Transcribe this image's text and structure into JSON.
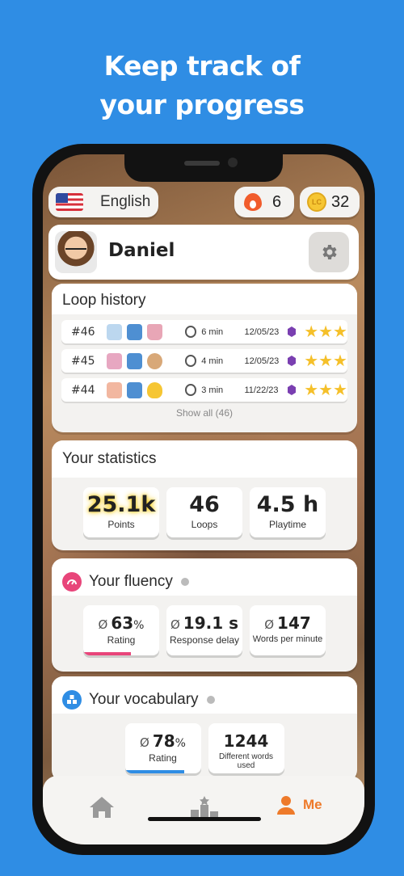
{
  "headline": [
    "Keep track of",
    "your progress"
  ],
  "top_bar": {
    "language": "English",
    "streak": "6",
    "coins": "32",
    "coin_mark": "LC"
  },
  "profile": {
    "name": "Daniel"
  },
  "loop_history": {
    "title": "Loop history",
    "rows": [
      {
        "num": "#46",
        "duration": "6 min",
        "date": "12/05/23",
        "stars": "★★★"
      },
      {
        "num": "#45",
        "duration": "4 min",
        "date": "12/05/23",
        "stars": "★★★"
      },
      {
        "num": "#44",
        "duration": "3 min",
        "date": "11/22/23",
        "stars": "★★★"
      }
    ],
    "show_all": "Show all (46)"
  },
  "statistics": {
    "title": "Your statistics",
    "tiles": [
      {
        "value": "25.1k",
        "label": "Points"
      },
      {
        "value": "46",
        "label": "Loops"
      },
      {
        "value": "4.5 h",
        "label": "Playtime"
      }
    ]
  },
  "fluency": {
    "title": "Your fluency",
    "tiles": [
      {
        "prefix": "Ø",
        "value": "63",
        "suffix": "%",
        "label": "Rating",
        "progress": 0.63
      },
      {
        "prefix": "Ø",
        "value": "19.1 s",
        "label": "Response delay"
      },
      {
        "prefix": "Ø",
        "value": "147",
        "label": "Words per minute"
      }
    ]
  },
  "vocabulary": {
    "title": "Your vocabulary",
    "tiles": [
      {
        "prefix": "Ø",
        "value": "78",
        "suffix": "%",
        "label": "Rating",
        "progress": 0.78
      },
      {
        "value": "1244",
        "label": "Different words used"
      }
    ]
  },
  "tabbar": {
    "me_label": "Me"
  },
  "colors": {
    "background": "#2f8de4",
    "accent": "#ee7a2a",
    "fluency_bar": "#e8457a",
    "vocab_bar": "#2f8de4",
    "star": "#f5c02a"
  }
}
